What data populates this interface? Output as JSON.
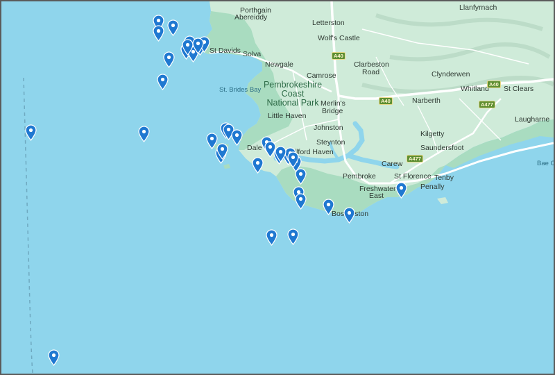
{
  "map": {
    "colors": {
      "water": "#8fd5ec",
      "land": "#cfebd9",
      "park": "#a9dcc0",
      "road": "#ffffff",
      "pin": "#1f78d1"
    },
    "places": {
      "llanfyrnach": "Llanfyrnach",
      "porthgain": "Porthgain",
      "abereiddy": "Abereiddy",
      "letterston": "Letterston",
      "wolfs_castle": "Wolf's Castle",
      "st_davids": "St Davids",
      "solva": "Solva",
      "newgale": "Newgale",
      "clarbeston": "Clarbeston",
      "road": "Road",
      "camrose": "Camrose",
      "clynderwen": "Clynderwen",
      "whitland": "Whitland",
      "st_clears": "St Clears",
      "st_brides_bay": "St. Brides Bay",
      "merlins_bridge_1": "Merlin's",
      "merlins_bridge_2": "Bridge",
      "narberth": "Narberth",
      "little_haven": "Little Haven",
      "laugharne": "Laugharne",
      "johnston": "Johnston",
      "kilgetty": "Kilgetty",
      "steynton": "Steynton",
      "dale": "Dale",
      "milford_haven": "Milford Haven",
      "saundersfoot": "Saundersfoot",
      "carew": "Carew",
      "bae_ca": "Bae Ca",
      "pembroke": "Pembroke",
      "st_florence": "St Florence",
      "tenby": "Tenby",
      "freshwater_east_1": "Freshwater",
      "freshwater_east_2": "East",
      "penally": "Penally",
      "bosherston": "Bosherston"
    },
    "park_name": [
      "Pembrokeshire",
      "Coast",
      "National Park"
    ],
    "roads": {
      "a40_north": "A40",
      "a40_east": "A40",
      "a40_mid": "A40",
      "a477_east": "A477",
      "a477_south": "A477"
    },
    "pins": [
      {
        "name": "pin"
      },
      {
        "name": "pin"
      },
      {
        "name": "pin"
      },
      {
        "name": "pin"
      },
      {
        "name": "pin"
      },
      {
        "name": "pin"
      },
      {
        "name": "pin"
      },
      {
        "name": "pin"
      },
      {
        "name": "pin"
      },
      {
        "name": "pin"
      },
      {
        "name": "pin"
      },
      {
        "name": "pin"
      },
      {
        "name": "pin"
      },
      {
        "name": "pin"
      },
      {
        "name": "pin"
      },
      {
        "name": "pin"
      },
      {
        "name": "pin"
      },
      {
        "name": "pin"
      },
      {
        "name": "pin"
      },
      {
        "name": "pin"
      },
      {
        "name": "pin"
      },
      {
        "name": "pin"
      },
      {
        "name": "pin"
      },
      {
        "name": "pin"
      },
      {
        "name": "pin"
      },
      {
        "name": "pin"
      },
      {
        "name": "pin"
      },
      {
        "name": "pin"
      },
      {
        "name": "pin"
      },
      {
        "name": "pin"
      },
      {
        "name": "pin"
      },
      {
        "name": "pin"
      },
      {
        "name": "pin"
      },
      {
        "name": "pin"
      },
      {
        "name": "pin"
      },
      {
        "name": "pin"
      },
      {
        "name": "pin"
      },
      {
        "name": "pin"
      }
    ]
  }
}
